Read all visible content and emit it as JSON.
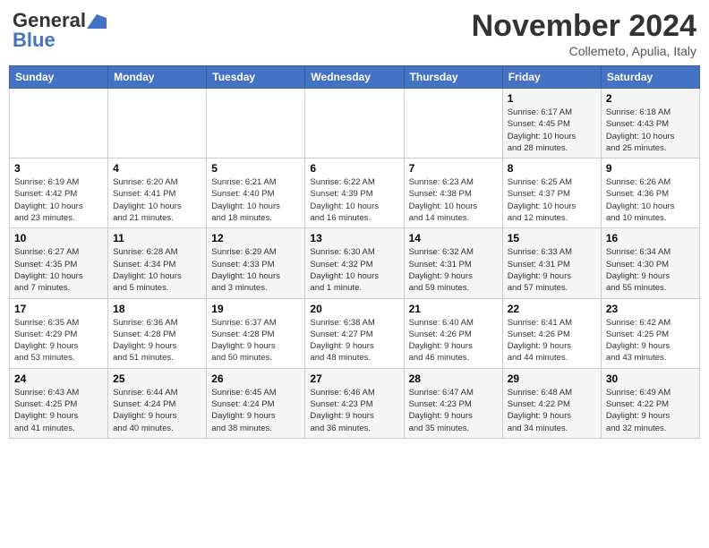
{
  "header": {
    "logo_general": "General",
    "logo_blue": "Blue",
    "month_title": "November 2024",
    "location": "Collemeto, Apulia, Italy"
  },
  "days_of_week": [
    "Sunday",
    "Monday",
    "Tuesday",
    "Wednesday",
    "Thursday",
    "Friday",
    "Saturday"
  ],
  "weeks": [
    [
      {
        "day": "",
        "info": ""
      },
      {
        "day": "",
        "info": ""
      },
      {
        "day": "",
        "info": ""
      },
      {
        "day": "",
        "info": ""
      },
      {
        "day": "",
        "info": ""
      },
      {
        "day": "1",
        "info": "Sunrise: 6:17 AM\nSunset: 4:45 PM\nDaylight: 10 hours\nand 28 minutes."
      },
      {
        "day": "2",
        "info": "Sunrise: 6:18 AM\nSunset: 4:43 PM\nDaylight: 10 hours\nand 25 minutes."
      }
    ],
    [
      {
        "day": "3",
        "info": "Sunrise: 6:19 AM\nSunset: 4:42 PM\nDaylight: 10 hours\nand 23 minutes."
      },
      {
        "day": "4",
        "info": "Sunrise: 6:20 AM\nSunset: 4:41 PM\nDaylight: 10 hours\nand 21 minutes."
      },
      {
        "day": "5",
        "info": "Sunrise: 6:21 AM\nSunset: 4:40 PM\nDaylight: 10 hours\nand 18 minutes."
      },
      {
        "day": "6",
        "info": "Sunrise: 6:22 AM\nSunset: 4:39 PM\nDaylight: 10 hours\nand 16 minutes."
      },
      {
        "day": "7",
        "info": "Sunrise: 6:23 AM\nSunset: 4:38 PM\nDaylight: 10 hours\nand 14 minutes."
      },
      {
        "day": "8",
        "info": "Sunrise: 6:25 AM\nSunset: 4:37 PM\nDaylight: 10 hours\nand 12 minutes."
      },
      {
        "day": "9",
        "info": "Sunrise: 6:26 AM\nSunset: 4:36 PM\nDaylight: 10 hours\nand 10 minutes."
      }
    ],
    [
      {
        "day": "10",
        "info": "Sunrise: 6:27 AM\nSunset: 4:35 PM\nDaylight: 10 hours\nand 7 minutes."
      },
      {
        "day": "11",
        "info": "Sunrise: 6:28 AM\nSunset: 4:34 PM\nDaylight: 10 hours\nand 5 minutes."
      },
      {
        "day": "12",
        "info": "Sunrise: 6:29 AM\nSunset: 4:33 PM\nDaylight: 10 hours\nand 3 minutes."
      },
      {
        "day": "13",
        "info": "Sunrise: 6:30 AM\nSunset: 4:32 PM\nDaylight: 10 hours\nand 1 minute."
      },
      {
        "day": "14",
        "info": "Sunrise: 6:32 AM\nSunset: 4:31 PM\nDaylight: 9 hours\nand 59 minutes."
      },
      {
        "day": "15",
        "info": "Sunrise: 6:33 AM\nSunset: 4:31 PM\nDaylight: 9 hours\nand 57 minutes."
      },
      {
        "day": "16",
        "info": "Sunrise: 6:34 AM\nSunset: 4:30 PM\nDaylight: 9 hours\nand 55 minutes."
      }
    ],
    [
      {
        "day": "17",
        "info": "Sunrise: 6:35 AM\nSunset: 4:29 PM\nDaylight: 9 hours\nand 53 minutes."
      },
      {
        "day": "18",
        "info": "Sunrise: 6:36 AM\nSunset: 4:28 PM\nDaylight: 9 hours\nand 51 minutes."
      },
      {
        "day": "19",
        "info": "Sunrise: 6:37 AM\nSunset: 4:28 PM\nDaylight: 9 hours\nand 50 minutes."
      },
      {
        "day": "20",
        "info": "Sunrise: 6:38 AM\nSunset: 4:27 PM\nDaylight: 9 hours\nand 48 minutes."
      },
      {
        "day": "21",
        "info": "Sunrise: 6:40 AM\nSunset: 4:26 PM\nDaylight: 9 hours\nand 46 minutes."
      },
      {
        "day": "22",
        "info": "Sunrise: 6:41 AM\nSunset: 4:26 PM\nDaylight: 9 hours\nand 44 minutes."
      },
      {
        "day": "23",
        "info": "Sunrise: 6:42 AM\nSunset: 4:25 PM\nDaylight: 9 hours\nand 43 minutes."
      }
    ],
    [
      {
        "day": "24",
        "info": "Sunrise: 6:43 AM\nSunset: 4:25 PM\nDaylight: 9 hours\nand 41 minutes."
      },
      {
        "day": "25",
        "info": "Sunrise: 6:44 AM\nSunset: 4:24 PM\nDaylight: 9 hours\nand 40 minutes."
      },
      {
        "day": "26",
        "info": "Sunrise: 6:45 AM\nSunset: 4:24 PM\nDaylight: 9 hours\nand 38 minutes."
      },
      {
        "day": "27",
        "info": "Sunrise: 6:46 AM\nSunset: 4:23 PM\nDaylight: 9 hours\nand 36 minutes."
      },
      {
        "day": "28",
        "info": "Sunrise: 6:47 AM\nSunset: 4:23 PM\nDaylight: 9 hours\nand 35 minutes."
      },
      {
        "day": "29",
        "info": "Sunrise: 6:48 AM\nSunset: 4:22 PM\nDaylight: 9 hours\nand 34 minutes."
      },
      {
        "day": "30",
        "info": "Sunrise: 6:49 AM\nSunset: 4:22 PM\nDaylight: 9 hours\nand 32 minutes."
      }
    ]
  ]
}
